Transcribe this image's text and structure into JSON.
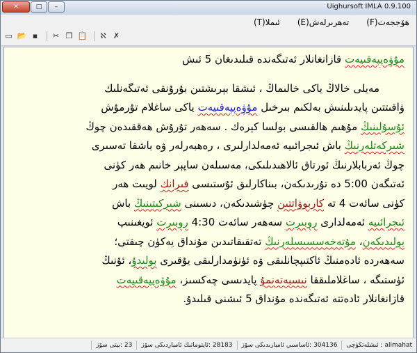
{
  "window": {
    "title": "Uighursoft IMLA 0.9.100",
    "close": "✕",
    "maximize": "□",
    "minimize": "–"
  },
  "menu": [
    "ھۆججەت(F)",
    "تەھرىرلەش(E)",
    "ئىملا(T)"
  ],
  "toolbar": {
    "icons": [
      "document-icon",
      "open-folder-icon",
      "save-icon",
      "cut-icon",
      "copy-icon",
      "paste-icon",
      "spellcheck-icon",
      "strikethrough-icon"
    ],
    "glyphs": [
      "▭",
      "📂",
      "▪",
      "✂",
      "❐",
      "📋",
      "ℵ",
      "✗"
    ]
  },
  "document": {
    "lines": [
      [
        {
          "t": "مۇۋەپپەقىيەت",
          "s": "g"
        },
        {
          "t": " قازانغانلار ئەتىگەندە قىلىدىغان 5 ئىش"
        }
      ],
      [],
      [
        {
          "t": "مەيلى خالاڭ ياكى خالىماڭ ، ئىشقا بېرىشتىن بۇرۇنقى ئەتىگەنلىك"
        }
      ],
      [
        {
          "t": "ۋاقىتتىن پايدىلىنىش بەلكىم بىرخىل "
        },
        {
          "t": "مۇۋەپپەقىيەت",
          "s": "b"
        },
        {
          "t": " ياكى ساغلام تۇرمۇش"
        }
      ],
      [
        {
          "t": "ئۇسۇلىنىڭ",
          "s": "g"
        },
        {
          "t": " مۇھىم ھالقىسى بولسا كېرەك . سەھەر تۇرۇش ھەققىدەن چوڭ"
        }
      ],
      [
        {
          "t": "شىركەتلەرنىڭ",
          "s": "g"
        },
        {
          "t": " باش ئىجرائىيە ئەمەلدارلىرى ، رەھبەرلەر ۋە باشقا تەسىرى"
        }
      ],
      [
        {
          "t": "چوڭ ئەربابلارنىڭ ئورتاق ئالاھىدىلىكى، مەسىلەن ساپېر خانىم ھەر كۈنى"
        }
      ],
      [
        {
          "t": "ئەتىگەن 5:00 دە تۇرىدىكەن، بىناكارلىق ئۇستىسى "
        },
        {
          "t": "فىرانك",
          "s": "r"
        },
        {
          "t": " لويىت ھەر"
        }
      ],
      [
        {
          "t": "كۈنى سائەت 4 تە "
        },
        {
          "t": "كاربوۋاتتىن",
          "s": "r"
        },
        {
          "t": " چۈشىدىكەن، دىسىنى "
        },
        {
          "t": "شىركىتىنىڭ",
          "s": "g"
        },
        {
          "t": " باش"
        }
      ],
      [
        {
          "t": "ئىجرائىيە",
          "s": "g"
        },
        {
          "t": " ئەمەلدارى "
        },
        {
          "t": "روبىرت",
          "s": "g"
        },
        {
          "t": " سەھەر سائەت 4:30 "
        },
        {
          "t": "روبىرت",
          "s": "g"
        },
        {
          "t": " ئويغىنىپ"
        }
      ],
      [
        {
          "t": "بولىدىكەن",
          "s": "g"
        },
        {
          "t": "، "
        },
        {
          "t": "مۇتەخەسسىسلەرنىڭ",
          "s": "g"
        },
        {
          "t": " تەتقىقاتىدىن مۇنداق يەكۈن چىقتى؛"
        }
      ],
      [
        {
          "t": "سەھەردە ئادەمنىڭ ئاكتىپچانلىقى ۋە ئۈنۈمدارلىقى يۇقىرى "
        },
        {
          "t": "بولىدۇ",
          "s": "g"
        },
        {
          "t": "، ئۇنىڭ"
        }
      ],
      [
        {
          "t": "ئۈستىگە ، ساغلاملىققا "
        },
        {
          "t": "نىسبەتەنمۇ",
          "s": "r"
        },
        {
          "t": " پايدىسى چەكسىز، "
        },
        {
          "t": "مۇۋەپپەقىيەت",
          "s": "g"
        }
      ],
      [
        {
          "t": "قازانغانلار ئادەتتە ئەتىگەندە مۇنداق 5 ئىشنى قىلىدۇ."
        }
      ]
    ]
  },
  "status": {
    "author_label": "ئىشلەتكۈچى :",
    "author_value": "alimahat",
    "total_label": "ئاساسىي ئامبارىدىكى سۆز:",
    "total_value": "304136",
    "ext_label": "ئاپتوماتىك ئامباردىكى سۆز:",
    "ext_value": "28183",
    "page_label": "بېتى سۆز:",
    "page_value": "23"
  },
  "colors": {
    "correct_green": "#138a13",
    "blue_word": "#1919e6",
    "red_word": "#a01414",
    "squiggle": "#e02020",
    "paper": "#fffee6"
  }
}
